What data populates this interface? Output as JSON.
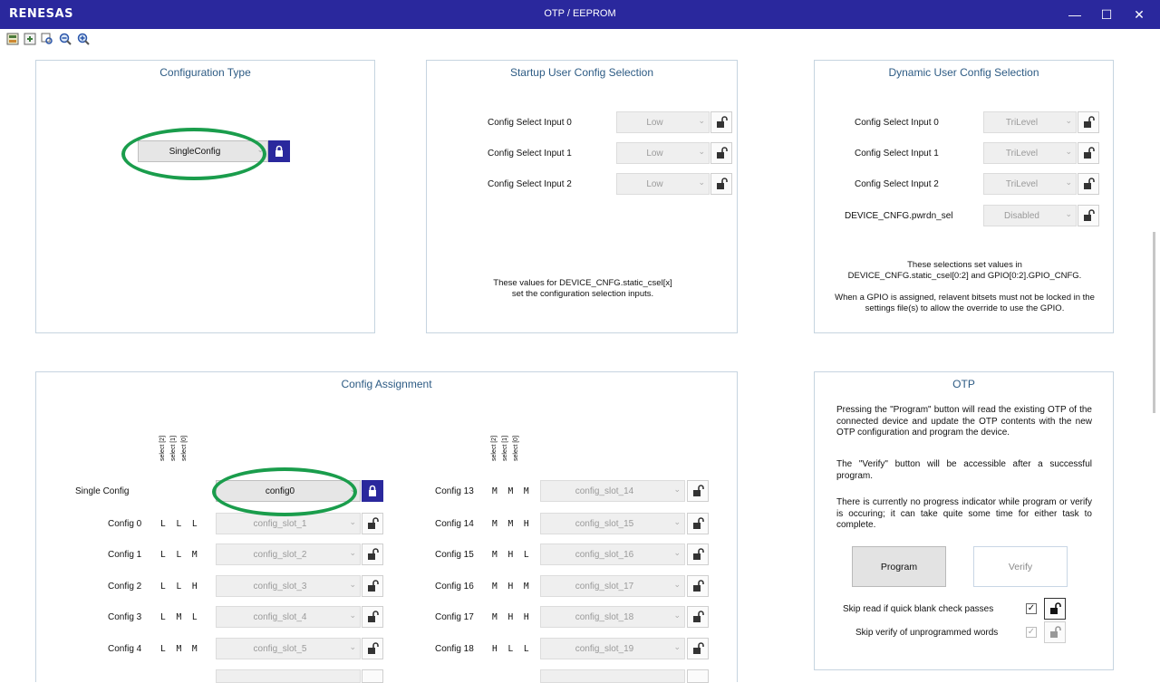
{
  "window": {
    "brand": "RENESAS",
    "title": "OTP / EEPROM",
    "controls": [
      "—",
      "☐",
      "✕"
    ]
  },
  "toolbar": {
    "icons": [
      "read-device-icon",
      "write-device-icon",
      "zoom-fit-icon",
      "zoom-out-icon",
      "zoom-in-icon"
    ]
  },
  "config_type": {
    "title": "Configuration Type",
    "value": "SingleConfig"
  },
  "startup": {
    "title": "Startup User Config Selection",
    "rows": [
      {
        "label": "Config Select Input 0",
        "value": "Low"
      },
      {
        "label": "Config Select Input 1",
        "value": "Low"
      },
      {
        "label": "Config Select Input 2",
        "value": "Low"
      }
    ],
    "note": "These values for DEVICE_CNFG.static_csel[x]\nset the configuration selection inputs."
  },
  "dynamic": {
    "title": "Dynamic User Config Selection",
    "rows": [
      {
        "label": "Config Select Input 0",
        "value": "TriLevel"
      },
      {
        "label": "Config Select Input 1",
        "value": "TriLevel"
      },
      {
        "label": "Config Select Input 2",
        "value": "TriLevel"
      },
      {
        "label": "DEVICE_CNFG.pwrdn_sel",
        "value": "Disabled"
      }
    ],
    "note1": "These selections set values in\nDEVICE_CNFG.static_csel[0:2] and GPIO[0:2].GPIO_CNFG.",
    "note2": "When a GPIO is assigned, relavent bitsets must not be locked in the\nsettings file(s) to allow the override to use the GPIO."
  },
  "assign": {
    "title": "Config Assignment",
    "headers": [
      "select [2]",
      "select [1]",
      "select [0]"
    ],
    "single": {
      "label": "Single Config",
      "value": "config0"
    },
    "left": [
      {
        "label": "Config 0",
        "codes": "L L L",
        "slot": "config_slot_1"
      },
      {
        "label": "Config 1",
        "codes": "L L M",
        "slot": "config_slot_2"
      },
      {
        "label": "Config 2",
        "codes": "L L H",
        "slot": "config_slot_3"
      },
      {
        "label": "Config 3",
        "codes": "L M L",
        "slot": "config_slot_4"
      },
      {
        "label": "Config 4",
        "codes": "L M M",
        "slot": "config_slot_5"
      }
    ],
    "right": [
      {
        "label": "Config 13",
        "codes": "M M M",
        "slot": "config_slot_14"
      },
      {
        "label": "Config 14",
        "codes": "M M H",
        "slot": "config_slot_15"
      },
      {
        "label": "Config 15",
        "codes": "M H L",
        "slot": "config_slot_16"
      },
      {
        "label": "Config 16",
        "codes": "M H M",
        "slot": "config_slot_17"
      },
      {
        "label": "Config 17",
        "codes": "M H H",
        "slot": "config_slot_18"
      },
      {
        "label": "Config 18",
        "codes": "H L L",
        "slot": "config_slot_19"
      }
    ]
  },
  "otp": {
    "title": "OTP",
    "p1": "Pressing the \"Program\" button will read the existing OTP of the connected device and update the OTP contents with the new OTP configuration and program the device.",
    "p2": "The \"Verify\" button will be accessible after a successful program.",
    "p3": "There is currently no progress indicator while program or verify is occuring; it can take quite some time for either task to complete.",
    "program_label": "Program",
    "verify_label": "Verify",
    "skip_read_label": "Skip read if quick blank check passes",
    "skip_verify_label": "Skip verify of unprogrammed words",
    "skip_read_checked": "✓",
    "skip_verify_checked": "✓"
  },
  "colors": {
    "titlebar": "#2a289d",
    "panel_title": "#2d5b84",
    "highlight": "#1a9d4c",
    "lock_active": "#2a289d"
  }
}
